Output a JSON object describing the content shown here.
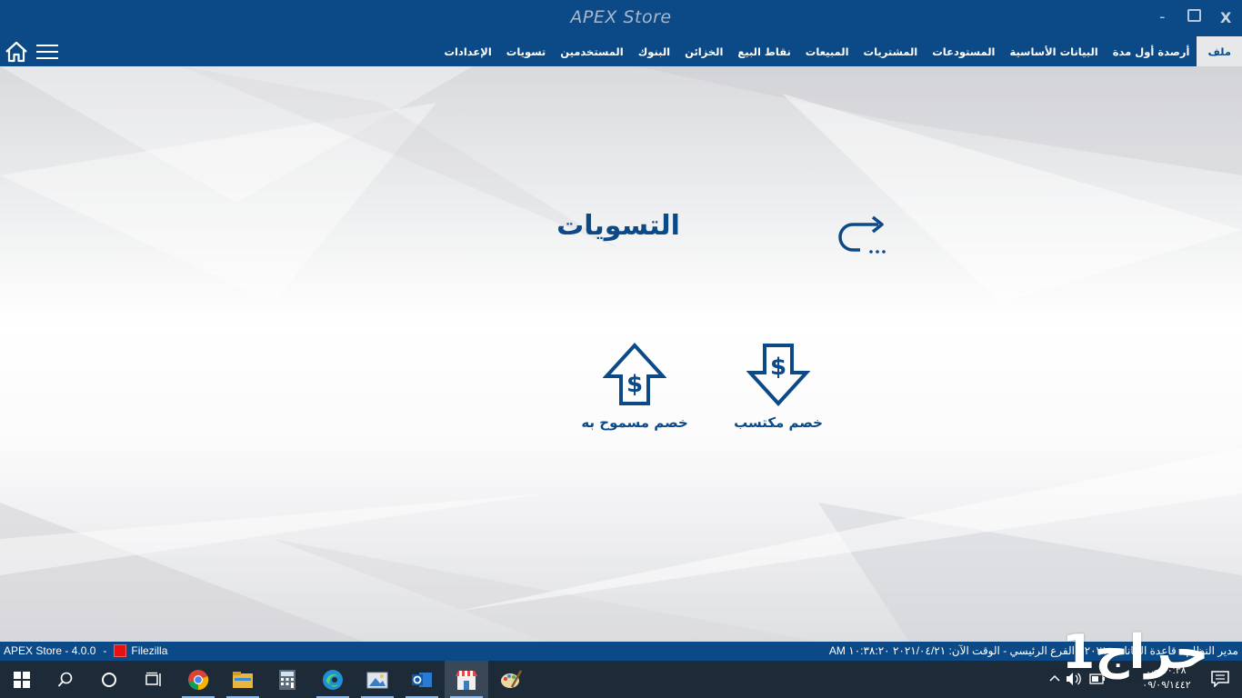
{
  "window": {
    "title": "APEX Store",
    "minimize": "-",
    "close": "X"
  },
  "menu": {
    "items": [
      "ملف",
      "أرصدة أول مدة",
      "البيانات الأساسية",
      "المستودعات",
      "المشتريات",
      "المبيعات",
      "نقاط البيع",
      "الخزائن",
      "البنوك",
      "المستخدمين",
      "تسويات",
      "الإعدادات"
    ],
    "active": "ملف"
  },
  "main": {
    "title": "التسويات",
    "tiles": {
      "earned_discount": "خصم مكتسب",
      "allowed_discount": "خصم مسموح به"
    }
  },
  "status": {
    "app_version": "APEX Store - 4.0.0",
    "separator": "-",
    "server": "Filezilla",
    "right_text": "مدير النظام - قاعدة البيانات: ٢٠٢١ - الفرع الرئيسي - الوقت الآن: ٢٠٢١/٠٤/٢١ ١٠:٣٨:٢٠ AM"
  },
  "taskbar": {
    "clock_time": "١٠:٣٨ ص",
    "clock_date": "٠٩/٠٩/١٤٤٢"
  },
  "watermark": "حراج1",
  "colors": {
    "brand_blue": "#0b4a86",
    "taskbar": "#1d2a38",
    "active_menu_bg": "#e6e8ea"
  }
}
